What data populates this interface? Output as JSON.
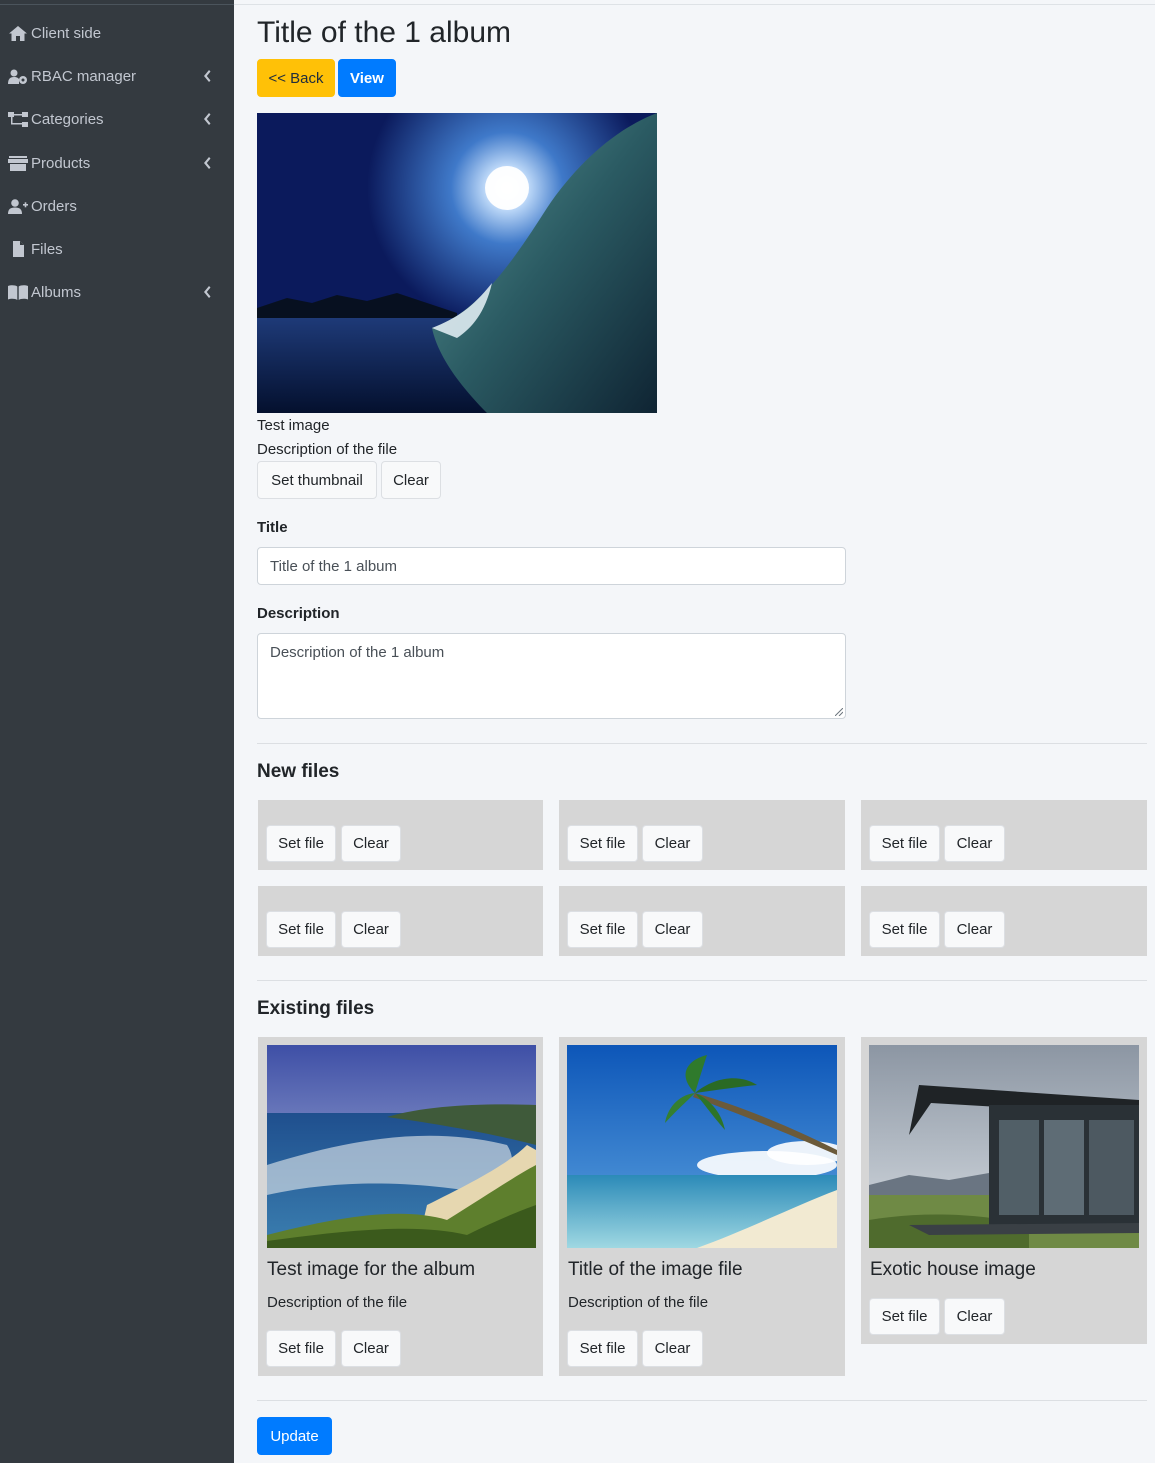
{
  "sidebar": {
    "items": [
      {
        "label": "Client side",
        "icon": "home-icon",
        "has_children": false
      },
      {
        "label": "RBAC manager",
        "icon": "users-cog-icon",
        "has_children": true
      },
      {
        "label": "Categories",
        "icon": "sitemap-icon",
        "has_children": true
      },
      {
        "label": "Products",
        "icon": "store-icon",
        "has_children": true
      },
      {
        "label": "Orders",
        "icon": "user-plus-icon",
        "has_children": false
      },
      {
        "label": "Files",
        "icon": "file-icon",
        "has_children": false
      },
      {
        "label": "Albums",
        "icon": "book-open-icon",
        "has_children": true
      }
    ]
  },
  "page": {
    "title": "Title of the 1 album",
    "back_label": "<< Back",
    "view_label": "View"
  },
  "thumbnail": {
    "name": "Test image",
    "description": "Description of the file",
    "set_label": "Set thumbnail",
    "clear_label": "Clear"
  },
  "form": {
    "title_label": "Title",
    "title_value": "Title of the 1 album",
    "description_label": "Description",
    "description_value": "Description of the 1 album"
  },
  "new_files": {
    "heading": "New files",
    "slots": [
      {
        "set_label": "Set file",
        "clear_label": "Clear"
      },
      {
        "set_label": "Set file",
        "clear_label": "Clear"
      },
      {
        "set_label": "Set file",
        "clear_label": "Clear"
      },
      {
        "set_label": "Set file",
        "clear_label": "Clear"
      },
      {
        "set_label": "Set file",
        "clear_label": "Clear"
      },
      {
        "set_label": "Set file",
        "clear_label": "Clear"
      }
    ]
  },
  "existing_files": {
    "heading": "Existing files",
    "items": [
      {
        "title": "Test image for the album",
        "description": "Description of the file",
        "set_label": "Set file",
        "clear_label": "Clear"
      },
      {
        "title": "Title of the image file",
        "description": "Description of the file",
        "set_label": "Set file",
        "clear_label": "Clear"
      },
      {
        "title": "Exotic house image",
        "description": "",
        "set_label": "Set file",
        "clear_label": "Clear"
      }
    ]
  },
  "update_label": "Update",
  "colors": {
    "sidebar_bg": "#343a40",
    "sidebar_text": "#c2c7d0",
    "primary": "#007bff",
    "warning": "#ffc107",
    "card_bg": "#d6d6d6",
    "page_bg": "#f4f6f9"
  }
}
